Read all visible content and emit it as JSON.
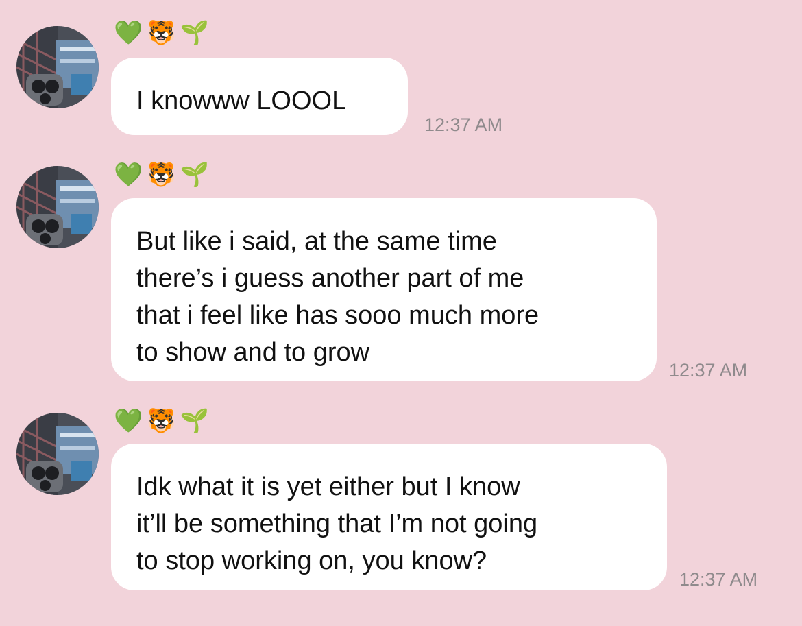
{
  "colors": {
    "background": "#f2d3da",
    "bubble": "#ffffff",
    "message_text": "#111111",
    "timestamp": "#8f8a8c"
  },
  "messages": [
    {
      "sender_name_emojis": [
        "💚",
        "🐯",
        "🌱"
      ],
      "lines": [
        "I knowww LOOOL"
      ],
      "time": "12:37 AM"
    },
    {
      "sender_name_emojis": [
        "💚",
        "🐯",
        "🌱"
      ],
      "lines": [
        "But like i said, at the same time",
        "there’s i guess another part of me",
        "that i feel like has sooo much more",
        "to show and to grow"
      ],
      "time": "12:37 AM"
    },
    {
      "sender_name_emojis": [
        "💚",
        "🐯",
        "🌱"
      ],
      "lines": [
        "Idk what it is yet either but I know",
        "it’ll be something that I’m not going",
        "to stop working on, you know?"
      ],
      "time": "12:37 AM"
    }
  ]
}
